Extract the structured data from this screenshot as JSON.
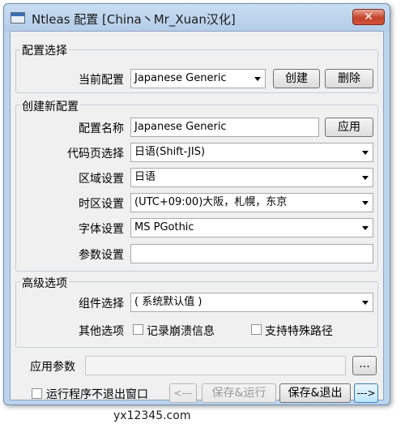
{
  "window": {
    "title": "Ntleas 配置 [China丶Mr_Xuan汉化]",
    "close_glyph": "✕"
  },
  "config_select": {
    "group_label": "配置选择",
    "current_label": "当前配置",
    "current_value": "Japanese Generic",
    "create_label": "创建",
    "delete_label": "删除"
  },
  "new_config": {
    "group_label": "创建新配置",
    "name_label": "配置名称",
    "name_value": "Japanese Generic",
    "apply_label": "应用",
    "codepage_label": "代码页选择",
    "codepage_value": "日语(Shift-JIS)",
    "region_label": "区域设置",
    "region_value": "日语",
    "timezone_label": "时区设置",
    "timezone_value": "(UTC+09:00)大阪，札幌，东京",
    "font_label": "字体设置",
    "font_value": "MS PGothic",
    "params_label": "参数设置",
    "params_value": ""
  },
  "advanced": {
    "group_label": "高级选项",
    "component_label": "组件选择",
    "component_value": "( 系统默认值 )",
    "other_label": "其他选项",
    "crash_log_label": "记录崩溃信息",
    "special_path_label": "支持特殊路径"
  },
  "bottom": {
    "app_params_label": "应用参数",
    "app_params_value": "",
    "browse_label": "...",
    "keep_window_label": "运行程序不退出窗口",
    "prev_label": "<---",
    "save_run_label": "保存&运行",
    "save_exit_label": "保存&退出",
    "next_label": "--->"
  },
  "watermark": "yx12345.com"
}
